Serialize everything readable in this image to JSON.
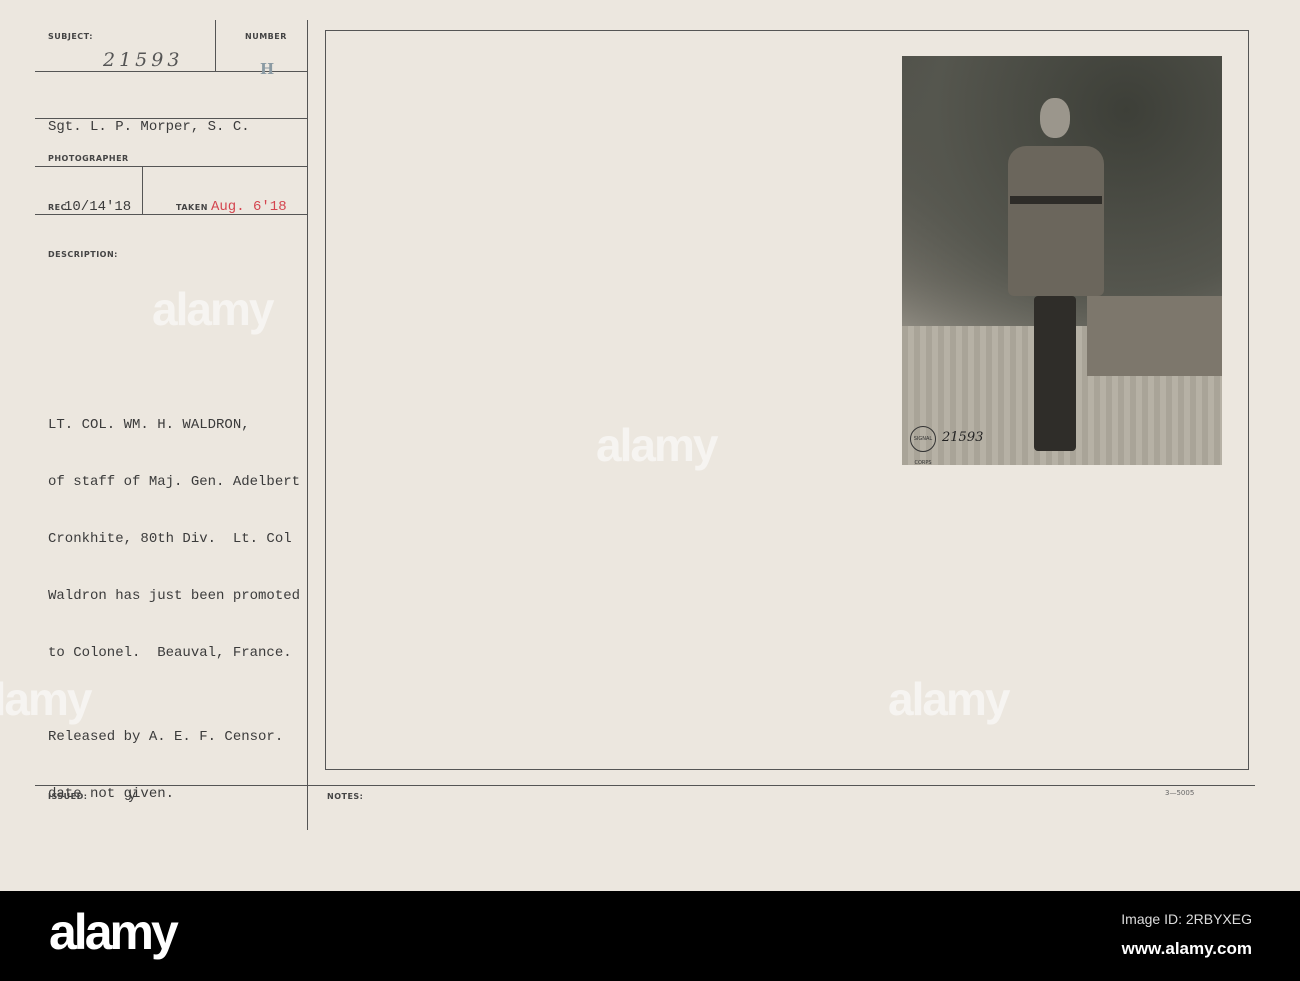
{
  "card": {
    "subject_label": "SUBJECT:",
    "number_label": "NUMBER",
    "subject_number": "21593",
    "number_stamp": "H",
    "photographer_name": "Sgt. L. P. Morper, S. C.",
    "photographer_label": "PHOTOGRAPHER",
    "rec_label": "REC",
    "rec_date": "10/14'18",
    "taken_label": "TAKEN",
    "taken_date": "Aug. 6'18",
    "description_label": "DESCRIPTION:",
    "description_lines": [
      "LT. COL. WM. H. WALDRON,",
      "of staff of Maj. Gen. Adelbert",
      "Cronkhite, 80th Div.  Lt. Col",
      "Waldron has just been promoted",
      "to Colonel.  Beauval, France."
    ],
    "release_lines": [
      "Released by A. E. F. Censor.",
      "date not given."
    ],
    "issued_label": "ISSUED:",
    "issued_value": "y",
    "notes_label": "NOTES:",
    "form_number": "3—5005",
    "photo_stamp": "SIGNAL CORPS U.S.A.",
    "photo_number": "21593"
  },
  "watermark": "alamy",
  "footer": {
    "logo": "alamy",
    "image_id": "Image ID: 2RBYXEG",
    "url": "www.alamy.com"
  }
}
